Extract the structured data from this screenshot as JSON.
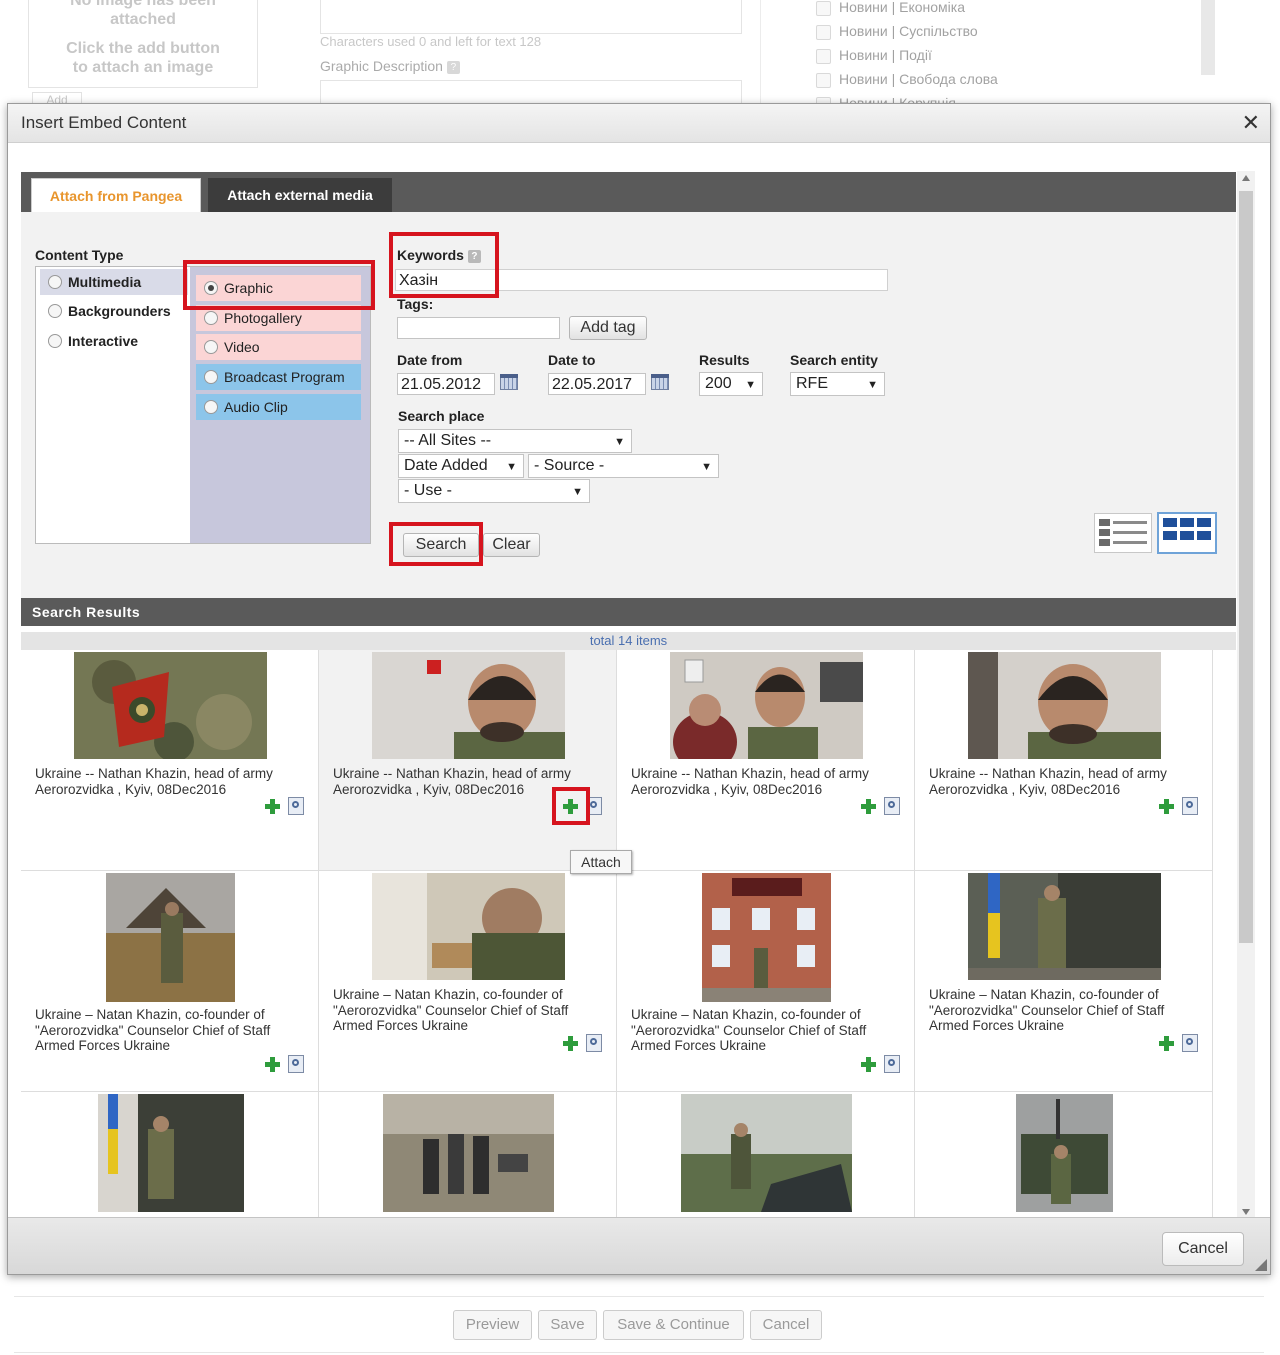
{
  "background_page": {
    "image_placeholder_text": [
      "No image has been",
      "attached",
      "Click the add button",
      "to attach an image"
    ],
    "add_button": "Add",
    "char_counter": "Characters used 0 and left for text 128",
    "graphic_description_label": "Graphic Description",
    "categories": [
      "Новини | Економіка",
      "Новини | Суспільство",
      "Новини | Події",
      "Новини | Свобода слова",
      "Новини | Корупція"
    ],
    "bottom_buttons": [
      "Preview",
      "Save",
      "Save & Continue",
      "Cancel"
    ]
  },
  "modal": {
    "title": "Insert Embed Content",
    "close_icon": "close-icon",
    "tabs": [
      {
        "label": "Attach from Pangea",
        "active": true
      },
      {
        "label": "Attach external media",
        "active": false
      }
    ],
    "content_type": {
      "label": "Content Type",
      "main_types": [
        "Multimedia",
        "Backgrounders",
        "Interactive"
      ],
      "sub_types": [
        {
          "label": "Graphic",
          "selected": true
        },
        {
          "label": "Photogallery",
          "selected": false
        },
        {
          "label": "Video",
          "selected": false
        },
        {
          "label": "Broadcast Program",
          "selected": false
        },
        {
          "label": "Audio Clip",
          "selected": false
        }
      ]
    },
    "keywords": {
      "label": "Keywords",
      "value": "Хазін"
    },
    "tags": {
      "label": "Tags:",
      "value": "",
      "add_button": "Add tag"
    },
    "date_from": {
      "label": "Date from",
      "value": "21.05.2012"
    },
    "date_to": {
      "label": "Date to",
      "value": "22.05.2017"
    },
    "results": {
      "label": "Results",
      "value": "200"
    },
    "search_entity": {
      "label": "Search entity",
      "value": "RFE"
    },
    "search_place": {
      "label": "Search place",
      "sites": "-- All Sites --",
      "sort": "Date Added",
      "source": "- Source -",
      "use": "- Use -"
    },
    "search_button": "Search",
    "clear_button": "Clear",
    "results_header": "Search Results",
    "total_items": "total 14 items",
    "results_items": [
      {
        "caption": "Ukraine -- Nathan Khazin, head of army Aerorozvidka , Kyiv, 08Dec2016"
      },
      {
        "caption": "Ukraine -- Nathan Khazin, head of army Aerorozvidka , Kyiv, 08Dec2016"
      },
      {
        "caption": "Ukraine -- Nathan Khazin, head of army Aerorozvidka , Kyiv, 08Dec2016"
      },
      {
        "caption": "Ukraine -- Nathan Khazin, head of army Aerorozvidka , Kyiv, 08Dec2016"
      },
      {
        "caption": "Ukraine – Natan Khazin, co-founder of \"Aerorozvidka\" Counselor Chief of Staff Armed Forces Ukraine"
      },
      {
        "caption": "Ukraine – Natan Khazin, co-founder of \"Aerorozvidka\" Counselor Chief of Staff Armed Forces Ukraine"
      },
      {
        "caption": "Ukraine – Natan Khazin, co-founder of \"Aerorozvidka\" Counselor Chief of Staff Armed Forces Ukraine"
      },
      {
        "caption": "Ukraine – Natan Khazin, co-founder of \"Aerorozvidka\" Counselor Chief of Staff Armed Forces Ukraine"
      },
      {
        "caption": ""
      },
      {
        "caption": ""
      },
      {
        "caption": ""
      },
      {
        "caption": ""
      }
    ],
    "attach_tooltip": "Attach",
    "cancel_button": "Cancel",
    "colors": {
      "highlight": "#d6141e",
      "active_tab_text": "#e8952d",
      "header_bar": "#5a5a5a",
      "subtype_pink": "#fbd5d5",
      "subtype_blue": "#8cc5ea",
      "add_icon": "#2e9c3c"
    }
  }
}
